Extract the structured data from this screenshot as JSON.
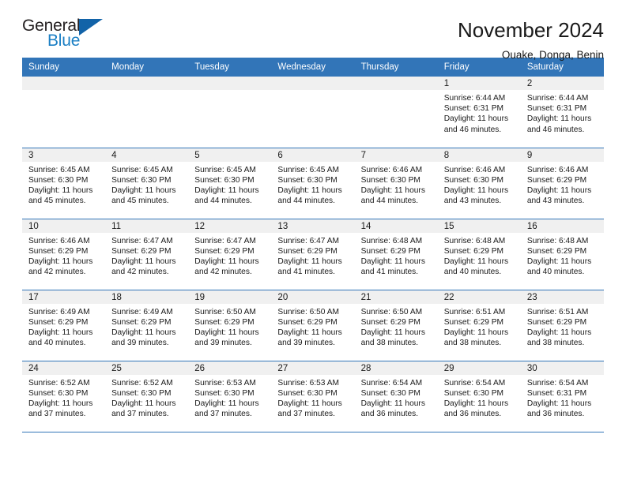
{
  "brand": {
    "name_part1": "General",
    "name_part2": "Blue",
    "triangle_color": "#1263a8",
    "blue_color": "#1b7fc4"
  },
  "header": {
    "title": "November 2024",
    "subtitle": "Ouake, Donga, Benin"
  },
  "theme": {
    "header_blue": "#3275b8",
    "daynum_band": "#f0f0f0"
  },
  "weekdays": [
    "Sunday",
    "Monday",
    "Tuesday",
    "Wednesday",
    "Thursday",
    "Friday",
    "Saturday"
  ],
  "labels": {
    "sunrise": "Sunrise:",
    "sunset": "Sunset:",
    "daylight": "Daylight:"
  },
  "weeks": [
    [
      {
        "day": "",
        "empty": true
      },
      {
        "day": "",
        "empty": true
      },
      {
        "day": "",
        "empty": true
      },
      {
        "day": "",
        "empty": true
      },
      {
        "day": "",
        "empty": true
      },
      {
        "day": "1",
        "sunrise": "Sunrise: 6:44 AM",
        "sunset": "Sunset: 6:31 PM",
        "daylight_line1": "Daylight: 11 hours",
        "daylight_line2": "and 46 minutes."
      },
      {
        "day": "2",
        "sunrise": "Sunrise: 6:44 AM",
        "sunset": "Sunset: 6:31 PM",
        "daylight_line1": "Daylight: 11 hours",
        "daylight_line2": "and 46 minutes."
      }
    ],
    [
      {
        "day": "3",
        "sunrise": "Sunrise: 6:45 AM",
        "sunset": "Sunset: 6:30 PM",
        "daylight_line1": "Daylight: 11 hours",
        "daylight_line2": "and 45 minutes."
      },
      {
        "day": "4",
        "sunrise": "Sunrise: 6:45 AM",
        "sunset": "Sunset: 6:30 PM",
        "daylight_line1": "Daylight: 11 hours",
        "daylight_line2": "and 45 minutes."
      },
      {
        "day": "5",
        "sunrise": "Sunrise: 6:45 AM",
        "sunset": "Sunset: 6:30 PM",
        "daylight_line1": "Daylight: 11 hours",
        "daylight_line2": "and 44 minutes."
      },
      {
        "day": "6",
        "sunrise": "Sunrise: 6:45 AM",
        "sunset": "Sunset: 6:30 PM",
        "daylight_line1": "Daylight: 11 hours",
        "daylight_line2": "and 44 minutes."
      },
      {
        "day": "7",
        "sunrise": "Sunrise: 6:46 AM",
        "sunset": "Sunset: 6:30 PM",
        "daylight_line1": "Daylight: 11 hours",
        "daylight_line2": "and 44 minutes."
      },
      {
        "day": "8",
        "sunrise": "Sunrise: 6:46 AM",
        "sunset": "Sunset: 6:30 PM",
        "daylight_line1": "Daylight: 11 hours",
        "daylight_line2": "and 43 minutes."
      },
      {
        "day": "9",
        "sunrise": "Sunrise: 6:46 AM",
        "sunset": "Sunset: 6:29 PM",
        "daylight_line1": "Daylight: 11 hours",
        "daylight_line2": "and 43 minutes."
      }
    ],
    [
      {
        "day": "10",
        "sunrise": "Sunrise: 6:46 AM",
        "sunset": "Sunset: 6:29 PM",
        "daylight_line1": "Daylight: 11 hours",
        "daylight_line2": "and 42 minutes."
      },
      {
        "day": "11",
        "sunrise": "Sunrise: 6:47 AM",
        "sunset": "Sunset: 6:29 PM",
        "daylight_line1": "Daylight: 11 hours",
        "daylight_line2": "and 42 minutes."
      },
      {
        "day": "12",
        "sunrise": "Sunrise: 6:47 AM",
        "sunset": "Sunset: 6:29 PM",
        "daylight_line1": "Daylight: 11 hours",
        "daylight_line2": "and 42 minutes."
      },
      {
        "day": "13",
        "sunrise": "Sunrise: 6:47 AM",
        "sunset": "Sunset: 6:29 PM",
        "daylight_line1": "Daylight: 11 hours",
        "daylight_line2": "and 41 minutes."
      },
      {
        "day": "14",
        "sunrise": "Sunrise: 6:48 AM",
        "sunset": "Sunset: 6:29 PM",
        "daylight_line1": "Daylight: 11 hours",
        "daylight_line2": "and 41 minutes."
      },
      {
        "day": "15",
        "sunrise": "Sunrise: 6:48 AM",
        "sunset": "Sunset: 6:29 PM",
        "daylight_line1": "Daylight: 11 hours",
        "daylight_line2": "and 40 minutes."
      },
      {
        "day": "16",
        "sunrise": "Sunrise: 6:48 AM",
        "sunset": "Sunset: 6:29 PM",
        "daylight_line1": "Daylight: 11 hours",
        "daylight_line2": "and 40 minutes."
      }
    ],
    [
      {
        "day": "17",
        "sunrise": "Sunrise: 6:49 AM",
        "sunset": "Sunset: 6:29 PM",
        "daylight_line1": "Daylight: 11 hours",
        "daylight_line2": "and 40 minutes."
      },
      {
        "day": "18",
        "sunrise": "Sunrise: 6:49 AM",
        "sunset": "Sunset: 6:29 PM",
        "daylight_line1": "Daylight: 11 hours",
        "daylight_line2": "and 39 minutes."
      },
      {
        "day": "19",
        "sunrise": "Sunrise: 6:50 AM",
        "sunset": "Sunset: 6:29 PM",
        "daylight_line1": "Daylight: 11 hours",
        "daylight_line2": "and 39 minutes."
      },
      {
        "day": "20",
        "sunrise": "Sunrise: 6:50 AM",
        "sunset": "Sunset: 6:29 PM",
        "daylight_line1": "Daylight: 11 hours",
        "daylight_line2": "and 39 minutes."
      },
      {
        "day": "21",
        "sunrise": "Sunrise: 6:50 AM",
        "sunset": "Sunset: 6:29 PM",
        "daylight_line1": "Daylight: 11 hours",
        "daylight_line2": "and 38 minutes."
      },
      {
        "day": "22",
        "sunrise": "Sunrise: 6:51 AM",
        "sunset": "Sunset: 6:29 PM",
        "daylight_line1": "Daylight: 11 hours",
        "daylight_line2": "and 38 minutes."
      },
      {
        "day": "23",
        "sunrise": "Sunrise: 6:51 AM",
        "sunset": "Sunset: 6:29 PM",
        "daylight_line1": "Daylight: 11 hours",
        "daylight_line2": "and 38 minutes."
      }
    ],
    [
      {
        "day": "24",
        "sunrise": "Sunrise: 6:52 AM",
        "sunset": "Sunset: 6:30 PM",
        "daylight_line1": "Daylight: 11 hours",
        "daylight_line2": "and 37 minutes."
      },
      {
        "day": "25",
        "sunrise": "Sunrise: 6:52 AM",
        "sunset": "Sunset: 6:30 PM",
        "daylight_line1": "Daylight: 11 hours",
        "daylight_line2": "and 37 minutes."
      },
      {
        "day": "26",
        "sunrise": "Sunrise: 6:53 AM",
        "sunset": "Sunset: 6:30 PM",
        "daylight_line1": "Daylight: 11 hours",
        "daylight_line2": "and 37 minutes."
      },
      {
        "day": "27",
        "sunrise": "Sunrise: 6:53 AM",
        "sunset": "Sunset: 6:30 PM",
        "daylight_line1": "Daylight: 11 hours",
        "daylight_line2": "and 37 minutes."
      },
      {
        "day": "28",
        "sunrise": "Sunrise: 6:54 AM",
        "sunset": "Sunset: 6:30 PM",
        "daylight_line1": "Daylight: 11 hours",
        "daylight_line2": "and 36 minutes."
      },
      {
        "day": "29",
        "sunrise": "Sunrise: 6:54 AM",
        "sunset": "Sunset: 6:30 PM",
        "daylight_line1": "Daylight: 11 hours",
        "daylight_line2": "and 36 minutes."
      },
      {
        "day": "30",
        "sunrise": "Sunrise: 6:54 AM",
        "sunset": "Sunset: 6:31 PM",
        "daylight_line1": "Daylight: 11 hours",
        "daylight_line2": "and 36 minutes."
      }
    ]
  ]
}
